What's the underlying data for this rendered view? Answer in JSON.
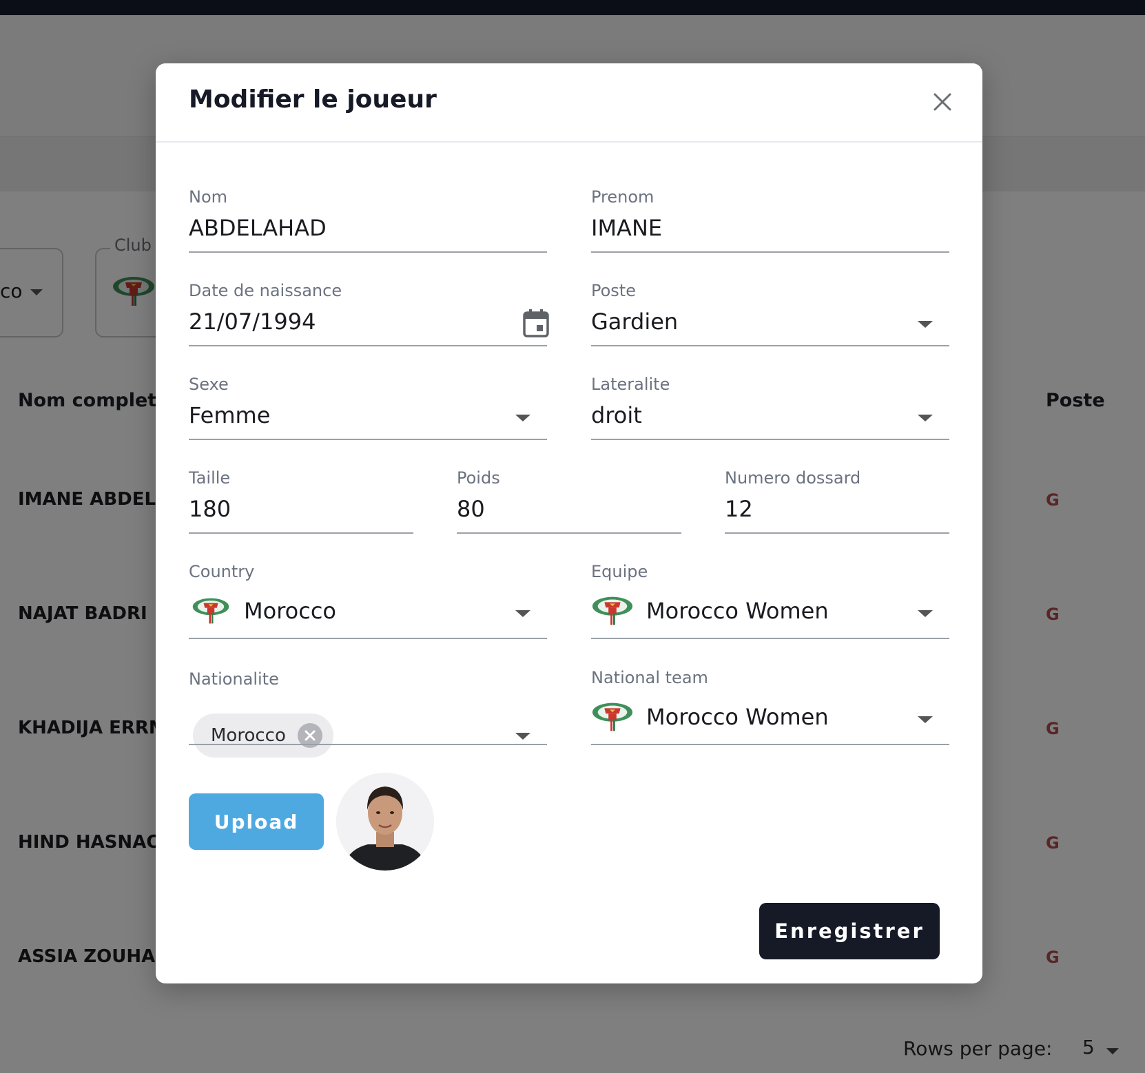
{
  "background": {
    "filters": {
      "country_value": "co",
      "club_label": "Club"
    },
    "table": {
      "headers": {
        "name": "Nom complet",
        "poste": "Poste"
      },
      "rows": [
        {
          "name": "IMANE ABDELA",
          "poste": "G"
        },
        {
          "name": "NAJAT BADRI",
          "poste": "G"
        },
        {
          "name": "KHADIJA ERRM",
          "poste": "G"
        },
        {
          "name": "HIND HASNAOU",
          "poste": "G"
        },
        {
          "name": "ASSIA ZOUHAIF",
          "poste": "G"
        }
      ]
    },
    "pagination": {
      "rows_per_page_label": "Rows per page:",
      "rows_per_page_value": "5"
    }
  },
  "modal": {
    "title": "Modifier le joueur",
    "fields": {
      "nom": {
        "label": "Nom",
        "value": "ABDELAHAD"
      },
      "prenom": {
        "label": "Prenom",
        "value": "IMANE"
      },
      "date_naissance": {
        "label": "Date de naissance",
        "value": "21/07/1994"
      },
      "poste": {
        "label": "Poste",
        "value": "Gardien"
      },
      "sexe": {
        "label": "Sexe",
        "value": "Femme"
      },
      "lateralite": {
        "label": "Lateralite",
        "value": "droit"
      },
      "taille": {
        "label": "Taille",
        "value": "180"
      },
      "poids": {
        "label": "Poids",
        "value": "80"
      },
      "numero_dossard": {
        "label": "Numero dossard",
        "value": "12"
      },
      "country": {
        "label": "Country",
        "value": "Morocco"
      },
      "equipe": {
        "label": "Equipe",
        "value": "Morocco Women"
      },
      "nationalite": {
        "label": "Nationalite",
        "chips": [
          "Morocco"
        ]
      },
      "national_team": {
        "label": "National team",
        "value": "Morocco Women"
      }
    },
    "buttons": {
      "upload": "Upload",
      "save": "Enregistrer"
    }
  },
  "colors": {
    "primary_dark": "#161a27",
    "upload_blue": "#4fa9e1",
    "poste_red": "#b24a4f"
  },
  "icons": [
    "close-icon",
    "calendar-icon",
    "chevron-down-icon",
    "morocco-federation-logo",
    "chip-remove-icon"
  ]
}
